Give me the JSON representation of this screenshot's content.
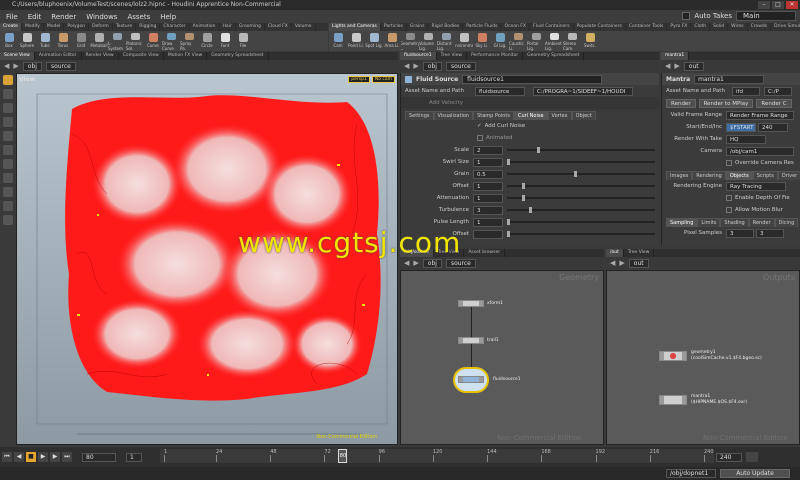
{
  "window": {
    "title": "C:/Users/bluphoenix/VolumeTest/scenes/lolz2.hipnc - Houdini Apprentice Non-Commercial",
    "buttons": [
      "–",
      "□",
      "✕"
    ]
  },
  "menubar": {
    "items": [
      "File",
      "Edit",
      "Render",
      "Windows",
      "Assets",
      "Help"
    ],
    "auto_takes_label": "Auto Takes",
    "desktop": "Main"
  },
  "shelf_left": {
    "tabs": [
      "Create",
      "Modify",
      "Model",
      "Polygon",
      "Deform",
      "Texture",
      "Rigging",
      "Character",
      "Animation",
      "Hair",
      "Grooming",
      "Cloud FX",
      "Volume"
    ],
    "tools": [
      "Box",
      "Sphere",
      "Tube",
      "Torus",
      "Grid",
      "Metaball",
      "L-System",
      "Platonic Sol.",
      "Curve",
      "Draw Curve",
      "Spray Pa.",
      "Circle",
      "Font",
      "File"
    ]
  },
  "shelf_right": {
    "tabs": [
      "Lights and Cameras",
      "Particles",
      "Grains",
      "Rigid Bodies",
      "Particle Fluids",
      "Ocean FX",
      "Fluid Containers",
      "Populate Containers",
      "Container Tools",
      "Pyro FX",
      "Cloth",
      "Solid",
      "Wires",
      "Crowds",
      "Drive Simulation"
    ],
    "tools": [
      "Cam",
      "Point Li.",
      "Spot Lig.",
      "Area Li.",
      "Geometry L.",
      "Volume Lig.",
      "Distant Lig.",
      "Environme.",
      "Sky Li.",
      "GI Lig.",
      "Caustic Li.",
      "Portal Lig.",
      "Ambient Lig.",
      "Stereo Cam.",
      "Switc."
    ]
  },
  "scene_view": {
    "tabs": [
      "Scene View",
      "Animation Editor",
      "Render View",
      "Composite View",
      "Motion FX View",
      "Geometry Spreadsheet"
    ],
    "path": [
      "obj",
      "source"
    ],
    "label": "View",
    "camera": [
      "persp1",
      "No cam"
    ],
    "noncommercial": "Non-Commercial Edition"
  },
  "watermark": "www.cgtsj.com",
  "param_editor": {
    "tabs": [
      "fluidsource1",
      "Tree View",
      "Performance Monitor",
      "Geometry Spreadsheet"
    ],
    "path": [
      "obj",
      "source"
    ],
    "node_type": "Fluid Source",
    "node_name": "fluidsource1",
    "asset_label": "Asset Name and Path",
    "asset_name": "fluidsource",
    "asset_path": "C:/PROGRA~1/SIDEEF~1/HOUDI",
    "add_velocity": "Add Velocity",
    "sub_tabs": [
      "Settings",
      "Visualization",
      "Stamp Points",
      "Curl Noise",
      "Vortex",
      "Object"
    ],
    "add_curl_noise": "Add Curl Noise",
    "animated": "Animated",
    "params": [
      {
        "label": "Scale",
        "value": "2",
        "frac": 0.2
      },
      {
        "label": "Swirl Size",
        "value": "1",
        "frac": 0.0
      },
      {
        "label": "Grain",
        "value": "0.5",
        "frac": 0.45
      },
      {
        "label": "Offset",
        "value": "1",
        "frac": 0.1
      },
      {
        "label": "Attenuation",
        "value": "1",
        "frac": 0.1
      },
      {
        "label": "Turbulence",
        "value": "3",
        "frac": 0.15
      },
      {
        "label": "Pulse Length",
        "value": "1",
        "frac": 0.0
      },
      {
        "label": "Offset",
        "value": "",
        "frac": 0.0
      }
    ]
  },
  "mantra": {
    "tabs": [
      "mantra1"
    ],
    "path": [
      "out"
    ],
    "node_type": "Mantra",
    "node_name": "mantra1",
    "asset_label": "Asset Name and Path",
    "asset_name": "ifd",
    "asset_path": "C:/P",
    "buttons": [
      "Render",
      "Render to MPlay",
      "Render C"
    ],
    "valid_frame": "Valid Frame Range",
    "render_frame_range": "Render Frame Range",
    "start_end_label": "Start/End/Inc",
    "start": "$FSTART",
    "end": "240",
    "take_label": "Render With Take",
    "take": "HQ",
    "camera_label": "Camera",
    "camera": "/obj/cam1",
    "override": "Override Camera Res",
    "sub_tabs": [
      "Images",
      "Rendering",
      "Objects",
      "Scripts",
      "Driver"
    ],
    "engine_label": "Rendering Engine",
    "engine": "Ray Tracing",
    "dof": "Enable Depth Of Fie",
    "mblur": "Allow Motion Blur",
    "sub_tabs2": [
      "Sampling",
      "Limits",
      "Shading",
      "Render",
      "Dicing"
    ],
    "pixel_samples_label": "Pixel Samples",
    "pixel_samples": [
      "3",
      "3"
    ]
  },
  "net_left": {
    "tabs": [
      "/obj/source",
      "Tree View",
      "Asset browser"
    ],
    "path": [
      "obj",
      "source"
    ],
    "context": "Geometry",
    "noncommercial": "Non-Commercial Edition",
    "nodes": [
      "xform1",
      "trail1",
      "fluidsource1"
    ]
  },
  "net_right": {
    "tabs": [
      "/out",
      "Tree View"
    ],
    "path": [
      "out"
    ],
    "context": "Outputs",
    "noncommercial": "Non-Commercial Edition",
    "nodes": [
      {
        "name": "geometry1",
        "sub": "(coolSimCache.v1.$F4.bgeo.sc)"
      },
      {
        "name": "mantra1",
        "sub": "($HIPNAME.$OS.$F4.exr)"
      }
    ]
  },
  "timeline": {
    "start": "80",
    "frame_field": "1",
    "current": "80",
    "end_field": "240",
    "end_field2": "240",
    "ticks": [
      "1",
      "24",
      "48",
      "72",
      "96",
      "120",
      "144",
      "168",
      "192",
      "216",
      "240"
    ],
    "tick_values": [
      1,
      24,
      48,
      72,
      96,
      120,
      144,
      168,
      192,
      216,
      240
    ]
  },
  "status": {
    "path": "/obj/dopnet1",
    "auto_update": "Auto Update"
  },
  "colors": {
    "accent": "#e6a52d",
    "watermark": "#f2e600",
    "smoke": "#ff0000"
  }
}
